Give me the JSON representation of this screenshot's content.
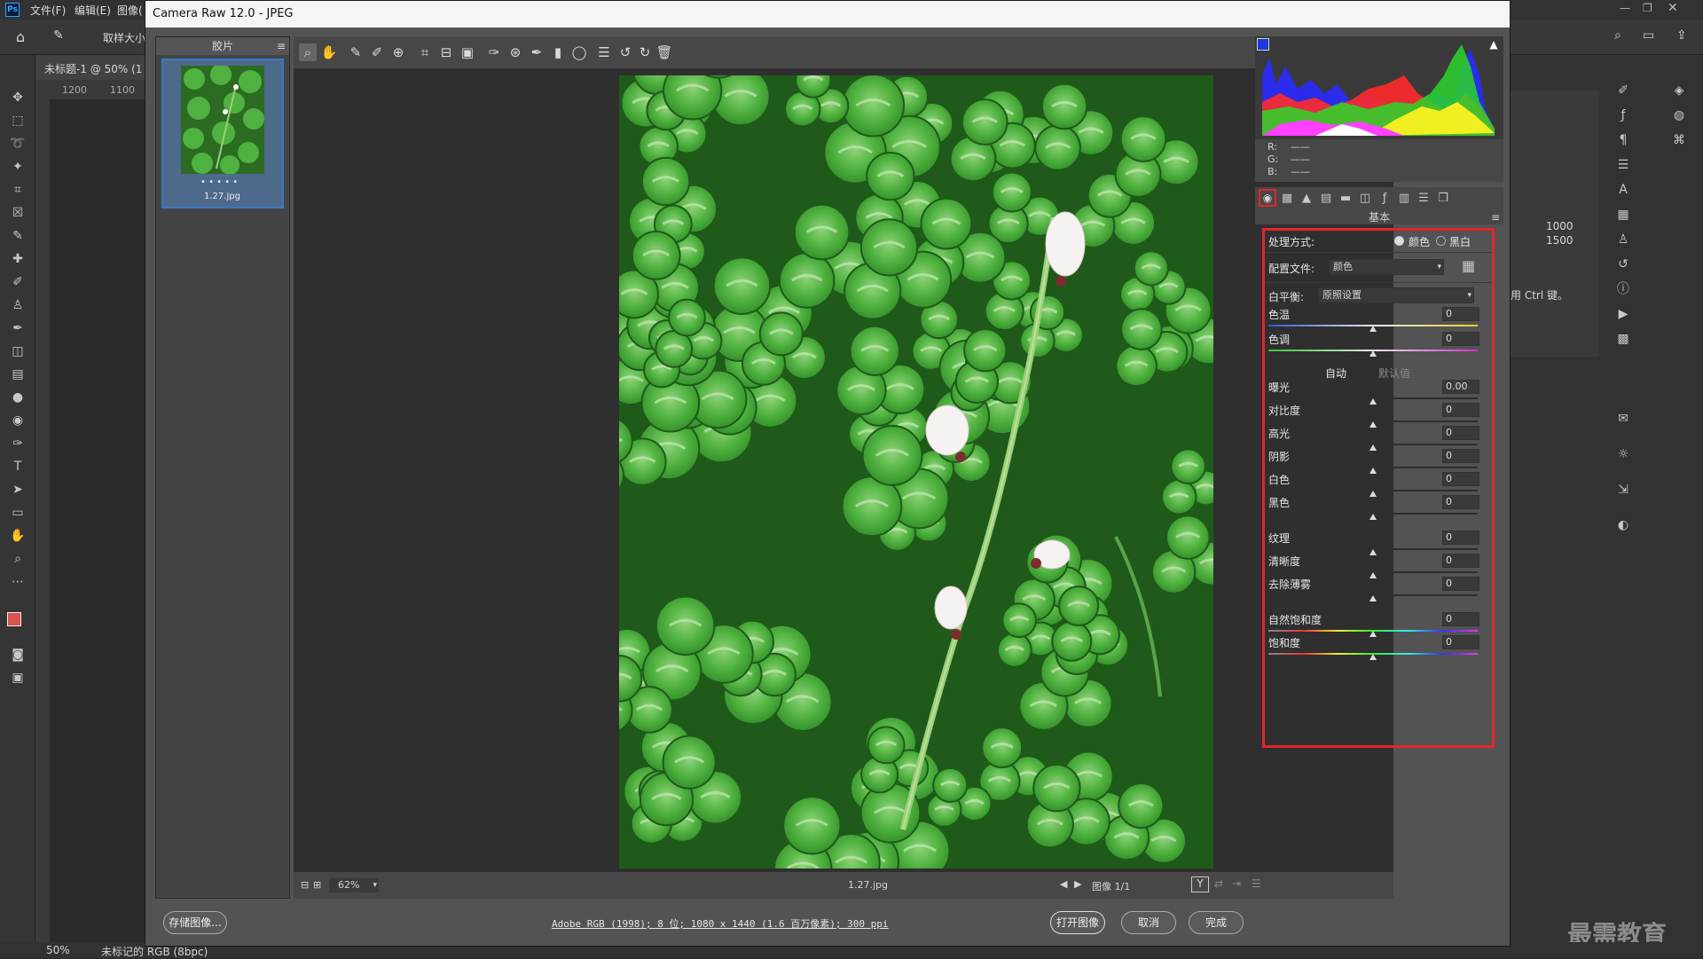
{
  "ps": {
    "menu": [
      "文件(F)",
      "编辑(E)",
      "图像("
    ],
    "option_label": "取样大小",
    "doc_tab": "未标题-1 @ 50% (1",
    "ruler_top": [
      "1200",
      "1100"
    ],
    "right_numbers": [
      "1000",
      "1500"
    ],
    "right_hint": "用 Ctrl 键。",
    "status_zoom": "50%",
    "status_doc": "未标记的 RGB (8bpc)",
    "watermark": "最需教育"
  },
  "cr": {
    "title": "Camera Raw 12.0 -  JPEG",
    "filmstrip": {
      "header": "胶片",
      "file_name": "1.27.jpg",
      "dots": "• • • • •"
    },
    "toolbar_icons": [
      "zoom-icon",
      "hand-icon",
      "white-balance-icon",
      "color-sampler-icon",
      "target-adjust-icon",
      "crop-icon",
      "straighten-icon",
      "transform-icon",
      "spot-removal-icon",
      "redeye-icon",
      "brush-icon",
      "graduated-filter-icon",
      "radial-filter-icon",
      "preferences-icon",
      "rotate-left-icon",
      "rotate-right-icon",
      "trash-icon"
    ],
    "canvas_status": {
      "zoom": "62%",
      "file_name": "1.27.jpg",
      "image_counter": "图像 1/1"
    },
    "workflow_link": "Adobe RGB (1998); 8 位; 1080 x 1440 (1.6 百万像素); 300 ppi",
    "buttons": {
      "save": "存储图像...",
      "open": "打开图像",
      "cancel": "取消",
      "done": "完成"
    },
    "rgb": {
      "r": "R:",
      "g": "G:",
      "b": "B:",
      "dash": "——"
    },
    "panel_title": "基本",
    "basic": {
      "process_label": "处理方式:",
      "process_color": "颜色",
      "process_bw": "黑白",
      "profile_label": "配置文件:",
      "profile_value": "颜色",
      "wb_label": "白平衡:",
      "wb_value": "原照设置",
      "auto": "自动",
      "default": "默认值",
      "sliders": [
        {
          "label": "色温",
          "value": "0",
          "thumb": 0.5,
          "gradient": "temp"
        },
        {
          "label": "色调",
          "value": "0",
          "thumb": 0.5,
          "gradient": "tint"
        },
        {
          "label": "曝光",
          "value": "0.00",
          "thumb": 0.5,
          "gradient": "plain"
        },
        {
          "label": "对比度",
          "value": "0",
          "thumb": 0.5,
          "gradient": "plain"
        },
        {
          "label": "高光",
          "value": "0",
          "thumb": 0.5,
          "gradient": "plain"
        },
        {
          "label": "阴影",
          "value": "0",
          "thumb": 0.5,
          "gradient": "plain"
        },
        {
          "label": "白色",
          "value": "0",
          "thumb": 0.5,
          "gradient": "plain"
        },
        {
          "label": "黑色",
          "value": "0",
          "thumb": 0.5,
          "gradient": "plain"
        },
        {
          "label": "纹理",
          "value": "0",
          "thumb": 0.5,
          "gradient": "plain"
        },
        {
          "label": "清晰度",
          "value": "0",
          "thumb": 0.5,
          "gradient": "plain"
        },
        {
          "label": "去除薄雾",
          "value": "0",
          "thumb": 0.5,
          "gradient": "plain"
        },
        {
          "label": "自然饱和度",
          "value": "0",
          "thumb": 0.5,
          "gradient": "sat"
        },
        {
          "label": "饱和度",
          "value": "0",
          "thumb": 0.5,
          "gradient": "sat"
        }
      ]
    }
  },
  "colors": {
    "highlight_border": "#e0262b",
    "selection": "#3a78c3",
    "leaf": "#3fa63a"
  }
}
